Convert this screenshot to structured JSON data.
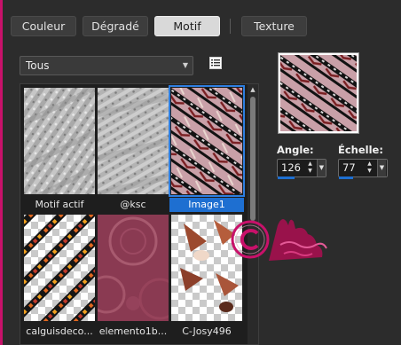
{
  "tabs": [
    {
      "label": "Couleur",
      "active": false
    },
    {
      "label": "Dégradé",
      "active": false
    },
    {
      "label": "Motif",
      "active": true
    },
    {
      "label": "Texture",
      "active": false
    }
  ],
  "category_select": {
    "value": "Tous"
  },
  "icons": {
    "list_view": "list-view-icon",
    "dropdown": "chevron-down-icon",
    "watermark": "copyright-seal"
  },
  "patterns": [
    {
      "name": "Motif actif",
      "selected": false
    },
    {
      "name": "@ksc",
      "selected": false
    },
    {
      "name": "Image1",
      "selected": true
    },
    {
      "name": "calguisdeco...",
      "selected": false
    },
    {
      "name": "elemento1b...",
      "selected": false
    },
    {
      "name": "C-Josy496",
      "selected": false
    }
  ],
  "settings": {
    "angle": {
      "label": "Angle:",
      "value": "126"
    },
    "scale": {
      "label": "Échelle:",
      "value": "77"
    }
  },
  "colors": {
    "accent": "#1e6fd1",
    "brand_pink": "#c8116a",
    "panel_bg": "#2c2c2c"
  }
}
